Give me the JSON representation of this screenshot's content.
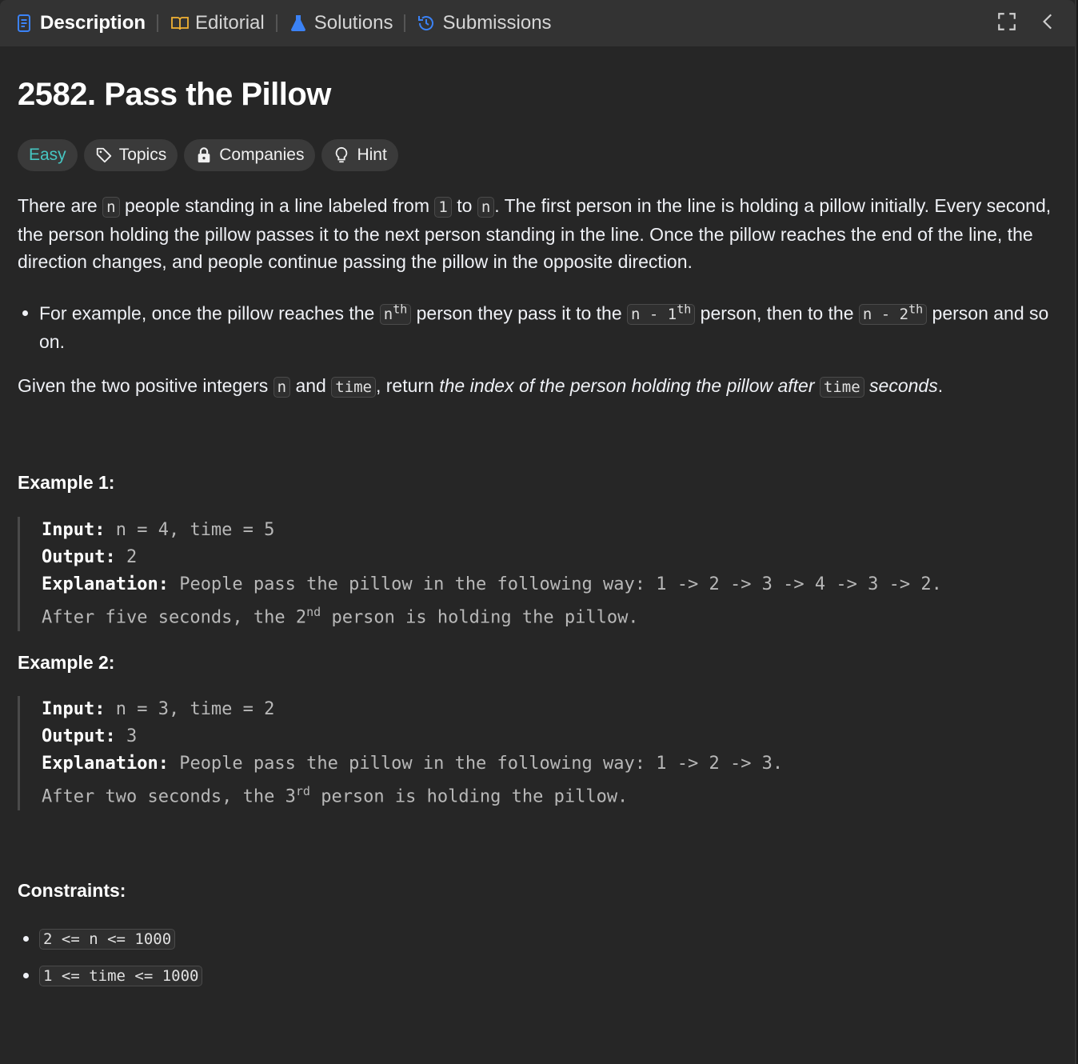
{
  "tabs": [
    {
      "label": "Description",
      "icon": "description-icon",
      "active": true
    },
    {
      "label": "Editorial",
      "icon": "book-icon",
      "active": false
    },
    {
      "label": "Solutions",
      "icon": "flask-icon",
      "active": false
    },
    {
      "label": "Submissions",
      "icon": "history-icon",
      "active": false
    }
  ],
  "toolbar": {
    "expand_icon": "expand-icon",
    "collapse_icon": "chevron-left-icon"
  },
  "problem": {
    "title": "2582. Pass the Pillow",
    "difficulty": "Easy",
    "pills": {
      "topics": "Topics",
      "companies": "Companies",
      "hint": "Hint"
    }
  },
  "description": {
    "p1_a": "There are ",
    "p1_n": "n",
    "p1_b": " people standing in a line labeled from ",
    "p1_one": "1",
    "p1_c": " to ",
    "p1_n2": "n",
    "p1_d": ". The first person in the line is holding a pillow initially. Every second, the person holding the pillow passes it to the next person standing in the line. Once the pillow reaches the end of the line, the direction changes, and people continue passing the pillow in the opposite direction.",
    "bullet_a": "For example, once the pillow reaches the ",
    "bullet_code1": "n",
    "bullet_sup1": "th",
    "bullet_b": " person they pass it to the ",
    "bullet_code2": "n - 1",
    "bullet_sup2": "th",
    "bullet_c": " person, then to the ",
    "bullet_code3": "n - 2",
    "bullet_sup3": "th",
    "bullet_d": " person and so on.",
    "p2_a": "Given the two positive integers ",
    "p2_n": "n",
    "p2_b": " and ",
    "p2_time": "time",
    "p2_c": ", return ",
    "p2_em1": "the index of the person holding the pillow after ",
    "p2_time2": "time",
    "p2_em2": " seconds",
    "p2_d": "."
  },
  "examples": [
    {
      "title": "Example 1:",
      "input_label": "Input:",
      "input": " n = 4, time = 5",
      "output_label": "Output:",
      "output": " 2",
      "explanation_label": "Explanation:",
      "explanation": " People pass the pillow in the following way: 1 -> 2 -> 3 -> 4 -> 3 -> 2.",
      "line2_a": "After five seconds, the 2",
      "line2_sup": "nd",
      "line2_b": " person is holding the pillow."
    },
    {
      "title": "Example 2:",
      "input_label": "Input:",
      "input": " n = 3, time = 2",
      "output_label": "Output:",
      "output": " 3",
      "explanation_label": "Explanation:",
      "explanation": " People pass the pillow in the following way: 1 -> 2 -> 3.",
      "line2_a": "After two seconds, the 3",
      "line2_sup": "rd",
      "line2_b": " person is holding the pillow."
    }
  ],
  "constraints": {
    "title": "Constraints:",
    "items": [
      "2 <= n <= 1000",
      "1 <= time <= 1000"
    ]
  }
}
